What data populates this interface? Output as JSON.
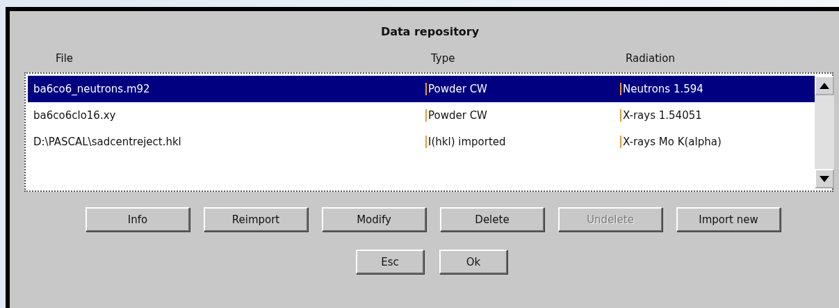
{
  "dialog": {
    "title": "Data repository"
  },
  "table": {
    "columns": [
      "File",
      "Type",
      "Radiation"
    ],
    "rows": [
      {
        "file": "ba6co6_neutrons.m92",
        "type": "Powder CW",
        "radiation": "Neutrons 1.594",
        "selected": true
      },
      {
        "file": "ba6co6clo16.xy",
        "type": "Powder CW",
        "radiation": "X-rays 1.54051",
        "selected": false
      },
      {
        "file": "D:\\PASCAL\\sadcentreject.hkl",
        "type": "I(hkl) imported",
        "radiation": "X-rays Mo K(alpha)",
        "selected": false
      }
    ]
  },
  "actions": [
    {
      "label": "Info",
      "disabled": false
    },
    {
      "label": "Reimport",
      "disabled": false
    },
    {
      "label": "Modify",
      "disabled": false
    },
    {
      "label": "Delete",
      "disabled": false
    },
    {
      "label": "Undelete",
      "disabled": true
    },
    {
      "label": "Import new",
      "disabled": false
    }
  ],
  "buttons": [
    "Esc",
    "Ok"
  ]
}
